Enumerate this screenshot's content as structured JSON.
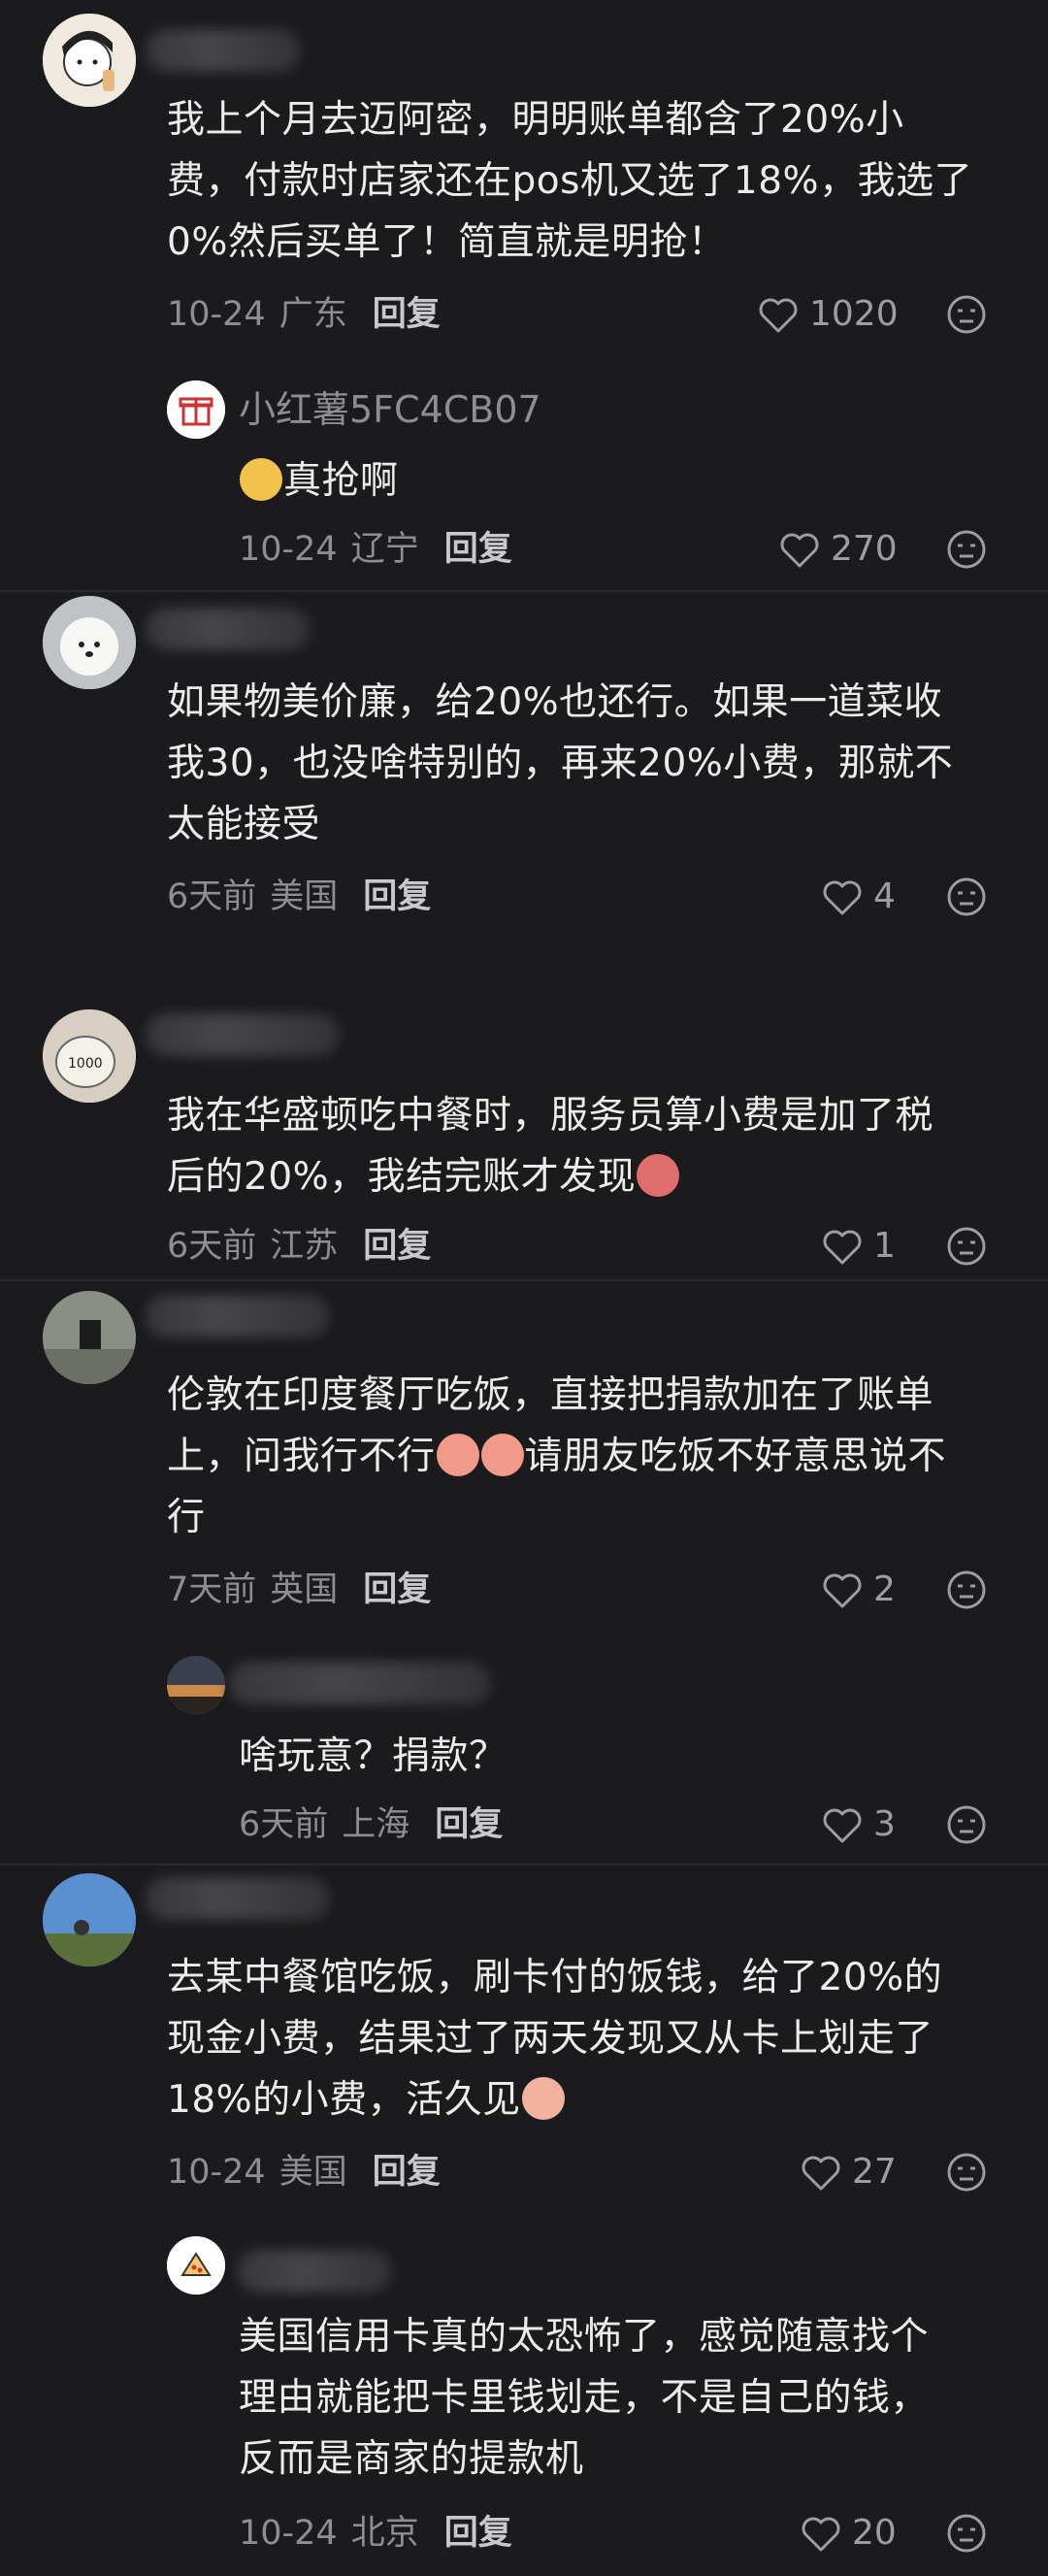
{
  "comments": [
    {
      "text_lines": [
        "我上个月去迈阿密，明明账单都含了20%小",
        "费，付款时店家还在pos机又选了18%，我选了",
        "0%然后买单了！简直就是明抢！"
      ],
      "date": "10-24",
      "location": "广东",
      "reply_label": "回复",
      "likes": "1020"
    },
    {
      "username": "小红薯5FC4CB07",
      "text_after_emoji": "真抢啊",
      "date": "10-24",
      "location": "辽宁",
      "reply_label": "回复",
      "likes": "270"
    },
    {
      "text_lines": [
        "如果物美价廉，给20%也还行。如果一道菜收",
        "我30，也没啥特别的，再来20%小费，那就不",
        "太能接受"
      ],
      "date": "6天前",
      "location": "美国",
      "reply_label": "回复",
      "likes": "4"
    },
    {
      "text_lines": [
        "我在华盛顿吃中餐时，服务员算小费是加了税",
        "后的20%，我结完账才发现"
      ],
      "date": "6天前",
      "location": "江苏",
      "reply_label": "回复",
      "likes": "1"
    },
    {
      "line1": "伦敦在印度餐厅吃饭，直接把捐款加在了账单",
      "line2_a": "上，问我行不行",
      "line2_b": "请朋友吃饭不好意思说不",
      "line3": "行",
      "date": "7天前",
      "location": "英国",
      "reply_label": "回复",
      "likes": "2"
    },
    {
      "text": "啥玩意？捐款？",
      "date": "6天前",
      "location": "上海",
      "reply_label": "回复",
      "likes": "3"
    },
    {
      "text_lines": [
        "去某中餐馆吃饭，刷卡付的饭钱，给了20%的",
        "现金小费，结果过了两天发现又从卡上划走了",
        "18%的小费，活久见"
      ],
      "date": "10-24",
      "location": "美国",
      "reply_label": "回复",
      "likes": "27"
    },
    {
      "text_lines": [
        "美国信用卡真的太恐怖了，感觉随意找个",
        "理由就能把卡里钱划走，不是自己的钱，",
        "反而是商家的提款机"
      ],
      "date": "10-24",
      "location": "北京",
      "reply_label": "回复",
      "likes": "20"
    }
  ],
  "colors": {
    "background": "#1b1b1d",
    "text": "#ececec",
    "meta": "#8d8d92"
  },
  "icons": [
    "heart-icon",
    "dislike-face-icon",
    "gift-icon",
    "emoji"
  ]
}
